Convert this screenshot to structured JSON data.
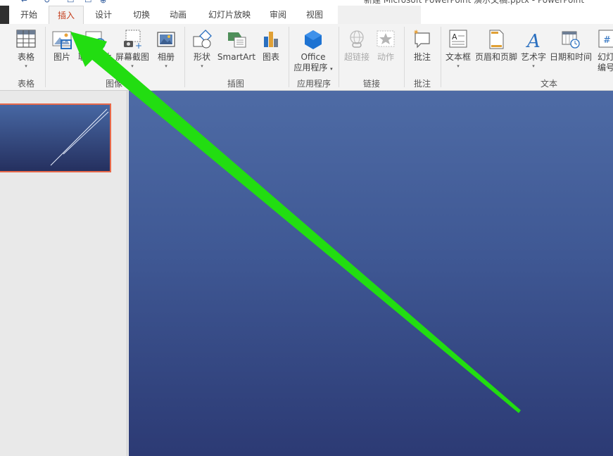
{
  "window": {
    "title": "新建 Microsoft PowerPoint 演示文稿.pptx - PowerPoint"
  },
  "tabs": [
    {
      "label": "开始"
    },
    {
      "label": "插入"
    },
    {
      "label": "设计"
    },
    {
      "label": "切换"
    },
    {
      "label": "动画"
    },
    {
      "label": "幻灯片放映"
    },
    {
      "label": "审阅"
    },
    {
      "label": "视图"
    }
  ],
  "active_tab": "插入",
  "ribbon": {
    "table_button": "表格",
    "picture_button": "图片",
    "online_picture_button": "联机图片",
    "screenshot_button": "屏幕截图",
    "album_button": "相册",
    "shapes_button": "形状",
    "smartart_button": "SmartArt",
    "chart_button": "图表",
    "office_apps_line1": "Office",
    "office_apps_line2": "应用程序",
    "hyperlink_button": "超链接",
    "action_button": "动作",
    "comment_button": "批注",
    "textbox_button": "文本框",
    "header_footer_button": "页眉和页脚",
    "wordart_button": "艺术字",
    "datetime_button": "日期和时间",
    "slide_number_line1": "幻灯",
    "slide_number_line2": "编号"
  },
  "groups": {
    "tables": "表格",
    "images": "图像",
    "illustrations": "插图",
    "apps": "应用程序",
    "links": "链接",
    "comments": "批注",
    "text": "文本"
  },
  "colors": {
    "accent_tab": "#c43e1c",
    "annotation_arrow": "#22dd11",
    "slide_top": "#4e6ba5",
    "slide_bottom": "#2c3a74",
    "thumb_border": "#e8694a"
  }
}
